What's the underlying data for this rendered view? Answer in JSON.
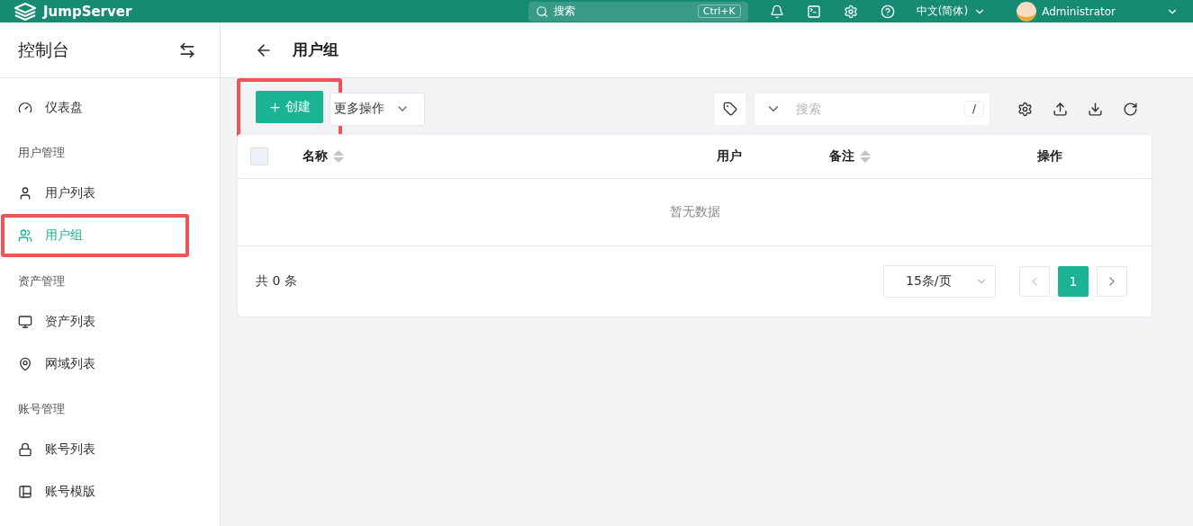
{
  "header": {
    "logo": "JumpServer",
    "search": {
      "placeholder": "搜索",
      "shortcut": "Ctrl+K"
    },
    "language": "中文(简体)",
    "user": "Administrator"
  },
  "sidebar": {
    "title": "控制台",
    "entries": [
      {
        "kind": "item",
        "label": "仪表盘",
        "selected": false,
        "highlighted": false
      },
      {
        "kind": "group",
        "label": "用户管理"
      },
      {
        "kind": "item",
        "label": "用户列表",
        "selected": false,
        "highlighted": false
      },
      {
        "kind": "item",
        "label": "用户组",
        "selected": true,
        "highlighted": true
      },
      {
        "kind": "group",
        "label": "资产管理"
      },
      {
        "kind": "item",
        "label": "资产列表",
        "selected": false,
        "highlighted": false
      },
      {
        "kind": "item",
        "label": "网域列表",
        "selected": false,
        "highlighted": false
      },
      {
        "kind": "group",
        "label": "账号管理"
      },
      {
        "kind": "item",
        "label": "账号列表",
        "selected": false,
        "highlighted": false
      },
      {
        "kind": "item",
        "label": "账号模版",
        "selected": false,
        "highlighted": false
      }
    ]
  },
  "page": {
    "title": "用户组"
  },
  "toolbar": {
    "create": {
      "label": "创建",
      "highlighted": true
    },
    "more": "更多操作",
    "search": {
      "placeholder": "搜索",
      "shortcut": "/"
    }
  },
  "table": {
    "select_all": {
      "checked": false
    },
    "columns": [
      {
        "label": "名称",
        "sortable": true
      },
      {
        "label": "用户",
        "sortable": false
      },
      {
        "label": "备注",
        "sortable": true
      },
      {
        "label": "操作",
        "sortable": false
      }
    ],
    "empty": "暂无数据"
  },
  "pagination": {
    "total": "共 0 条",
    "page_size": "15条/页",
    "prev": {
      "disabled": true
    },
    "pages": [
      {
        "label": "1",
        "selected": true
      }
    ],
    "next": {
      "disabled": false
    }
  }
}
